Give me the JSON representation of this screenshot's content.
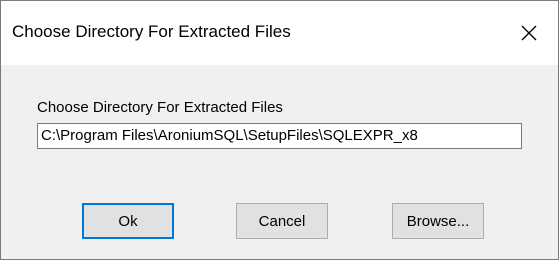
{
  "window": {
    "title": "Choose Directory For Extracted Files",
    "close_icon": "close-icon"
  },
  "form": {
    "label": "Choose Directory For Extracted Files",
    "path_value": "C:\\Program Files\\AroniumSQL\\SetupFiles\\SQLEXPR_x8"
  },
  "buttons": {
    "ok": "Ok",
    "cancel": "Cancel",
    "browse": "Browse..."
  },
  "colors": {
    "focus_border": "#0078d7",
    "button_face": "#e1e1e1",
    "dialog_background": "#f0f0f0"
  }
}
